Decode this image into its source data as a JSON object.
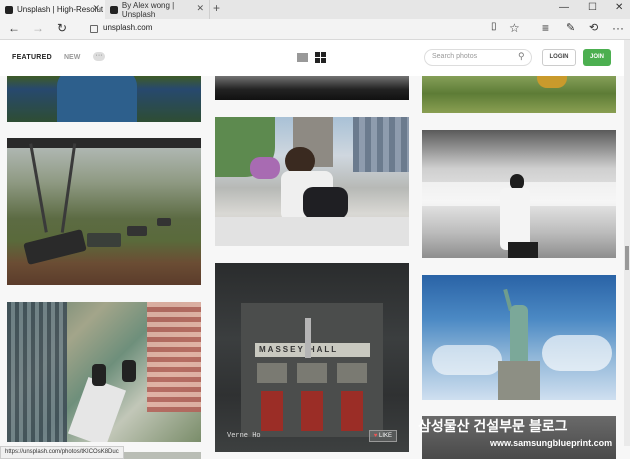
{
  "browser": {
    "tabs": [
      {
        "title": "Unsplash | High-Resolut",
        "active": true
      },
      {
        "title": "By Alex wong | Unsplash",
        "active": false
      }
    ],
    "new_tab": "+",
    "window_controls": [
      "—",
      "☐",
      "✕"
    ],
    "url": "unsplash.com",
    "status_url": "https://unsplash.com/photos/tKICOsK8Duc"
  },
  "site": {
    "nav": {
      "featured": "FEATURED",
      "new": "NEW",
      "more": "···"
    },
    "search_placeholder": "Search photos",
    "login": "LOGIN",
    "join": "JOIN"
  },
  "photos": {
    "credit": "Verne Ho",
    "like": "LIKE"
  },
  "watermark": {
    "line1": "삼성물산 건설부문 블로그",
    "line2": "www.samsungblueprint.com"
  },
  "colors": {
    "join": "#4caf50",
    "accent_red": "#e55"
  }
}
